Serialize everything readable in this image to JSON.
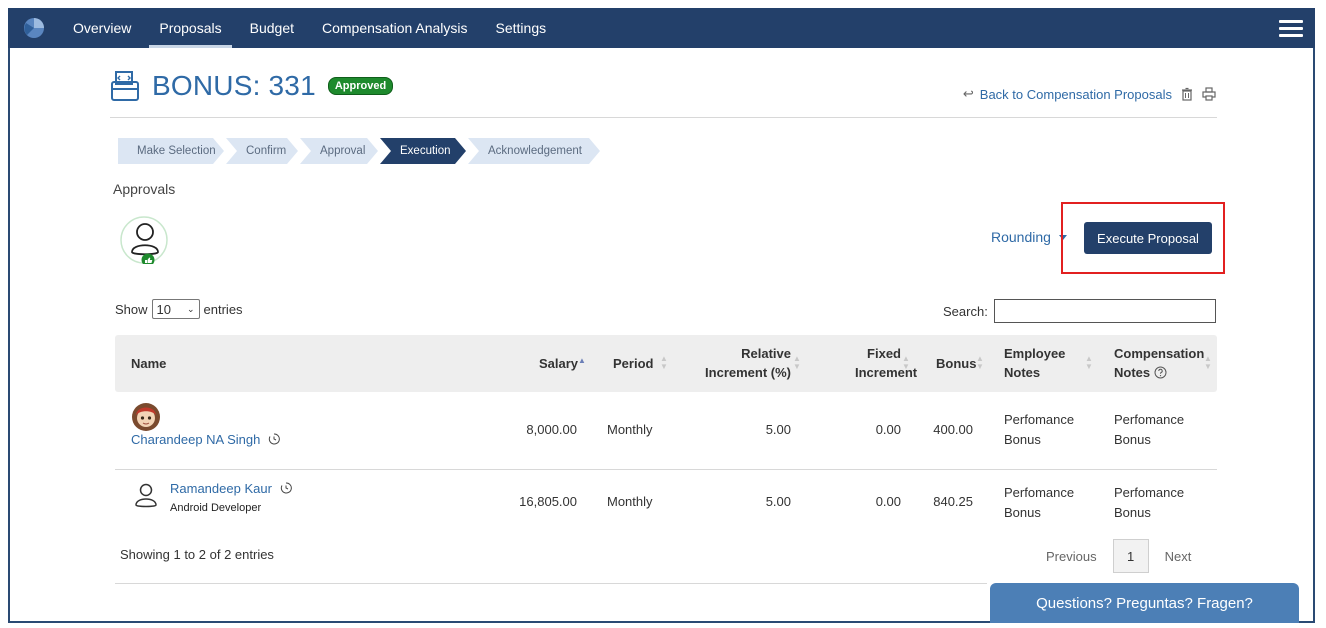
{
  "nav": {
    "tabs": [
      {
        "label": "Overview"
      },
      {
        "label": "Proposals"
      },
      {
        "label": "Budget"
      },
      {
        "label": "Compensation Analysis"
      },
      {
        "label": "Settings"
      }
    ],
    "active_tab": "Proposals",
    "menu_icon": "hamburger-icon",
    "logo_icon": "app-logo-icon"
  },
  "header": {
    "title": "BONUS: 331",
    "status_badge": "Approved",
    "back_link": "Back to Compensation Proposals",
    "actions": [
      "trash-icon",
      "print-icon"
    ]
  },
  "steps": [
    {
      "label": "Make Selection"
    },
    {
      "label": "Confirm"
    },
    {
      "label": "Approval"
    },
    {
      "label": "Execution"
    },
    {
      "label": "Acknowledgement"
    }
  ],
  "active_step": "Execution",
  "approvals": {
    "label": "Approvals",
    "approver_icon": "user-approved-icon"
  },
  "actions": {
    "rounding_label": "Rounding",
    "execute_label": "Execute Proposal"
  },
  "table_controls": {
    "show_label": "Show",
    "entries_value": "10",
    "entries_label": "entries",
    "search_label": "Search:",
    "search_value": ""
  },
  "table": {
    "columns": [
      "Name",
      "Salary",
      "Period",
      "Relative Increment (%)",
      "Fixed Increment",
      "Bonus",
      "Employee Notes",
      "Compensation Notes"
    ],
    "rows": [
      {
        "name": "Charandeep NA Singh",
        "subtitle": "",
        "salary": "8,000.00",
        "period": "Monthly",
        "relative_increment": "5.00",
        "fixed_increment": "0.00",
        "bonus": "400.00",
        "employee_notes": "Perfomance Bonus",
        "compensation_notes": "Perfomance Bonus"
      },
      {
        "name": "Ramandeep Kaur",
        "subtitle": "Android Developer",
        "salary": "16,805.00",
        "period": "Monthly",
        "relative_increment": "5.00",
        "fixed_increment": "0.00",
        "bonus": "840.25",
        "employee_notes": "Perfomance Bonus",
        "compensation_notes": "Perfomance Bonus"
      }
    ]
  },
  "footer": {
    "showing_text": "Showing 1 to 2 of 2 entries",
    "previous_label": "Previous",
    "current_page": "1",
    "next_label": "Next"
  },
  "chat_widget": {
    "label": "Questions? Preguntas? Fragen?"
  },
  "colors": {
    "nav_bg": "#23406a",
    "link": "#2f6aa6",
    "approved_badge": "#1e8a2d",
    "highlight_border": "#e22020",
    "chat_bg": "#4c7fb6"
  }
}
